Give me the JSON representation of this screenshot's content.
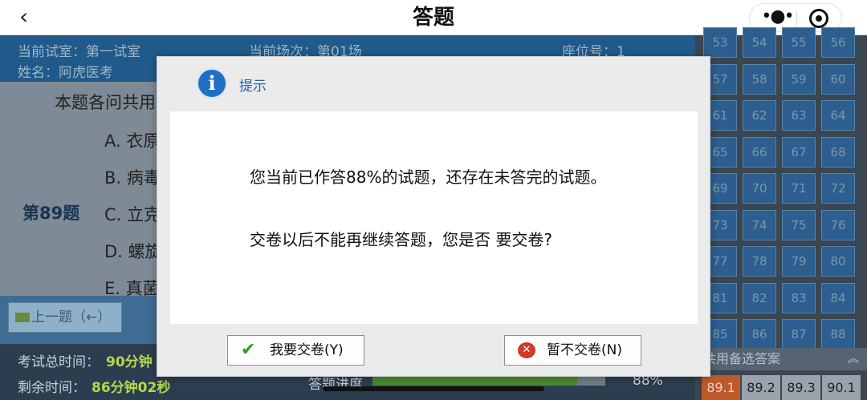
{
  "nav": {
    "back_icon": "chevron-left-icon",
    "back_glyph": "‹",
    "title": "答题",
    "more_glyph": "•●•"
  },
  "exam": {
    "room_label": "当前试室：第一试室",
    "session_label": "当前场次：第01场",
    "seat_label": "座位号：1",
    "name_label": "姓名：阿虎医考",
    "stem": "本题各问共用",
    "question_no": "第89题",
    "options": [
      "A. 衣原",
      "B. 病毒",
      "C. 立克",
      "D. 螺旋",
      "E. 真菌"
    ],
    "prev_button": "上一题（←）",
    "total_time_label": "考试总时间：",
    "total_time_value": "90分钟",
    "remain_time_label": "剩余时间：",
    "remain_time_value": "86分钟02秒",
    "progress_label": "答题进度",
    "progress_percent": 88,
    "progress_text": "88%"
  },
  "grid": {
    "numbers": [
      "53",
      "54",
      "55",
      "56",
      "57",
      "58",
      "59",
      "60",
      "61",
      "62",
      "63",
      "64",
      "65",
      "66",
      "67",
      "68",
      "69",
      "70",
      "71",
      "72",
      "73",
      "74",
      "75",
      "76",
      "77",
      "78",
      "79",
      "80",
      "81",
      "82",
      "83",
      "84",
      "85",
      "86",
      "87",
      "88"
    ],
    "answers_header": "共用备选答案",
    "answers": [
      "89.1",
      "89.2",
      "89.3",
      "90.1"
    ],
    "active_answer": "89.1"
  },
  "dialog": {
    "icon": "info-icon",
    "icon_glyph": "i",
    "title": "提示",
    "message_line1": "您当前已作答88%的试题，还存在未答完的试题。",
    "message_line2": "交卷以后不能再继续答题，您是否 要交卷?",
    "confirm_label": "我要交卷(Y)",
    "cancel_label": "暂不交卷(N)",
    "confirm_glyph": "✔",
    "cancel_glyph": "✕"
  },
  "colors": {
    "accent": "#1f6fc4",
    "confirm": "#3a9a2a",
    "cancel": "#d23a2a",
    "exam_bg": "#1f5a8a"
  }
}
